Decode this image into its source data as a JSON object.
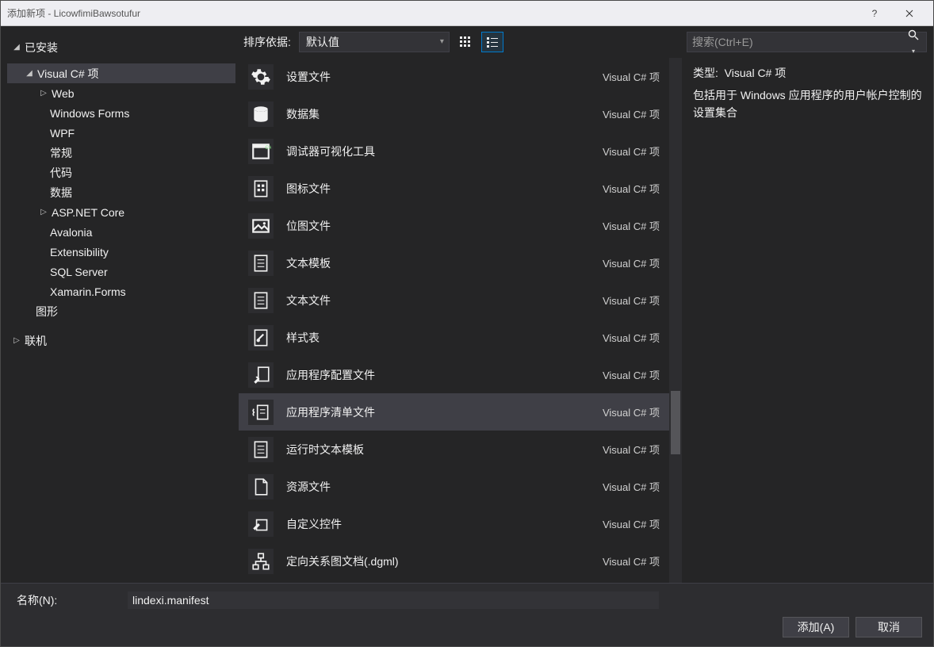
{
  "titlebar": {
    "title": "添加新项 - LicowfimiBawsotufur",
    "help": "?",
    "close": "×"
  },
  "tree": {
    "root": "已安装",
    "vcs": "Visual C# 项",
    "items": [
      "Web",
      "Windows Forms",
      "WPF",
      "常规",
      "代码",
      "数据",
      "ASP.NET Core",
      "Avalonia",
      "Extensibility",
      "SQL Server",
      "Xamarin.Forms"
    ],
    "graphics": "图形",
    "online": "联机"
  },
  "sort": {
    "label": "排序依据:",
    "value": "默认值"
  },
  "search": {
    "placeholder": "搜索(Ctrl+E)"
  },
  "type_col": "Visual C# 项",
  "templates": [
    {
      "name": "设置文件",
      "icon": "gear"
    },
    {
      "name": "数据集",
      "icon": "db"
    },
    {
      "name": "调试器可视化工具",
      "icon": "window"
    },
    {
      "name": "图标文件",
      "icon": "file-grid"
    },
    {
      "name": "位图文件",
      "icon": "image"
    },
    {
      "name": "文本模板",
      "icon": "file-lines"
    },
    {
      "name": "文本文件",
      "icon": "file-lines"
    },
    {
      "name": "样式表",
      "icon": "file-brush"
    },
    {
      "name": "应用程序配置文件",
      "icon": "wrench-file"
    },
    {
      "name": "应用程序清单文件",
      "icon": "manifest",
      "selected": true
    },
    {
      "name": "运行时文本模板",
      "icon": "file-lines"
    },
    {
      "name": "资源文件",
      "icon": "file-blank"
    },
    {
      "name": "自定义控件",
      "icon": "pencil-square"
    },
    {
      "name": "定向关系图文档(.dgml)",
      "icon": "diagram"
    }
  ],
  "detail": {
    "type_label": "类型:",
    "type_value": "Visual C# 项",
    "desc": "包括用于 Windows 应用程序的用户帐户控制的设置集合"
  },
  "name": {
    "label": "名称(N):",
    "value": "lindexi.manifest"
  },
  "buttons": {
    "add": "添加(A)",
    "cancel": "取消"
  }
}
